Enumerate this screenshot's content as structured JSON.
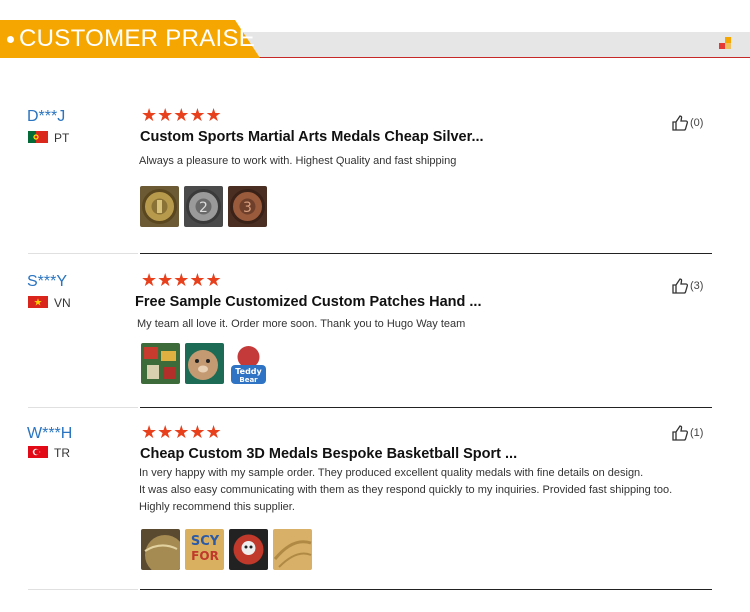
{
  "header": {
    "title": "CUSTOMER PRAISE"
  },
  "colors": {
    "accent": "#f5a600",
    "star": "#e8401c",
    "username": "#2a74c0"
  },
  "reviews": [
    {
      "user": "D***J",
      "country": "PT",
      "flag": "portugal-flag",
      "rating": 5,
      "stars": "★★★★★",
      "title": "Custom Sports Martial Arts Medals Cheap Silver...",
      "lines": [
        "Always a pleasure to work with. Highest Quality and fast shipping"
      ],
      "likes": "(0)"
    },
    {
      "user": "S***Y",
      "country": "VN",
      "flag": "vietnam-flag",
      "rating": 5,
      "stars": "★★★★★",
      "title": "Free Sample Customized Custom Patches Hand ...",
      "lines": [
        "My team all love it. Order more soon. Thank you to Hugo Way team"
      ],
      "likes": "(3)"
    },
    {
      "user": "W***H",
      "country": "TR",
      "flag": "turkey-flag",
      "rating": 5,
      "stars": "★★★★★",
      "title": "Cheap Custom 3D Medals Bespoke Basketball Sport ...",
      "lines": [
        "In very happy with my sample order. They produced excellent quality medals with fine details on design.",
        "It was also easy communicating with them as they respond quickly to my inquiries. Provided fast shipping too.",
        "Highly recommend this supplier."
      ],
      "likes": "(1)"
    }
  ]
}
